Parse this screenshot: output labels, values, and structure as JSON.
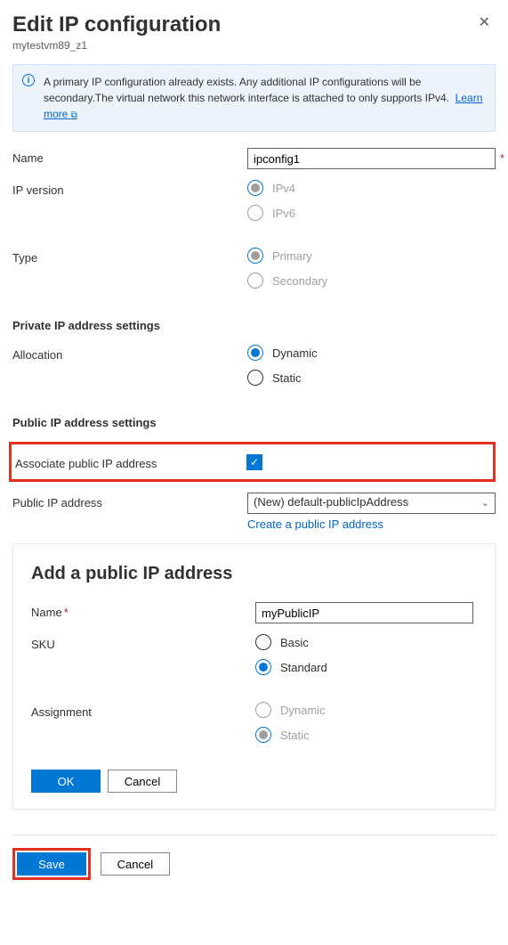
{
  "header": {
    "title": "Edit IP configuration",
    "subtitle": "mytestvm89_z1"
  },
  "info": {
    "text": "A primary IP configuration already exists. Any additional IP configurations will be secondary.The virtual network this network interface is attached to only supports IPv4.",
    "learn_more": "Learn more"
  },
  "fields": {
    "name_label": "Name",
    "name_value": "ipconfig1",
    "ipversion_label": "IP version",
    "ipversion_opt1": "IPv4",
    "ipversion_opt2": "IPv6",
    "type_label": "Type",
    "type_opt1": "Primary",
    "type_opt2": "Secondary"
  },
  "private": {
    "section": "Private IP address settings",
    "alloc_label": "Allocation",
    "alloc_opt1": "Dynamic",
    "alloc_opt2": "Static"
  },
  "public": {
    "section": "Public IP address settings",
    "assoc_label": "Associate public IP address",
    "addr_label": "Public IP address",
    "addr_value": "(New) default-publicIpAddress",
    "create_link": "Create a public IP address"
  },
  "add_panel": {
    "title": "Add a public IP address",
    "name_label": "Name",
    "name_value": "myPublicIP",
    "sku_label": "SKU",
    "sku_opt1": "Basic",
    "sku_opt2": "Standard",
    "assign_label": "Assignment",
    "assign_opt1": "Dynamic",
    "assign_opt2": "Static",
    "ok": "OK",
    "cancel": "Cancel"
  },
  "footer": {
    "save": "Save",
    "cancel": "Cancel"
  }
}
